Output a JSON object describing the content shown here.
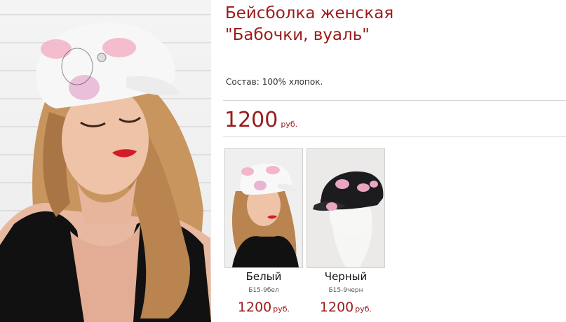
{
  "product": {
    "title_line1": "Бейсболка женская",
    "title_line2": "\"Бабочки, вуаль\"",
    "composition_label": "Состав:",
    "composition_value": "100% хлопок.",
    "price": "1200",
    "currency": "руб."
  },
  "variants": [
    {
      "name": "Белый",
      "sku": "Б15-9бел",
      "price": "1200",
      "currency": "руб.",
      "image_icon": "white-cap-photo-icon"
    },
    {
      "name": "Черный",
      "sku": "Б15-9черн",
      "price": "1200",
      "currency": "руб.",
      "image_icon": "black-cap-photo-icon"
    }
  ],
  "colors": {
    "accent": "#9b1b1b",
    "divider": "#d6d6d6",
    "text": "#333333"
  }
}
